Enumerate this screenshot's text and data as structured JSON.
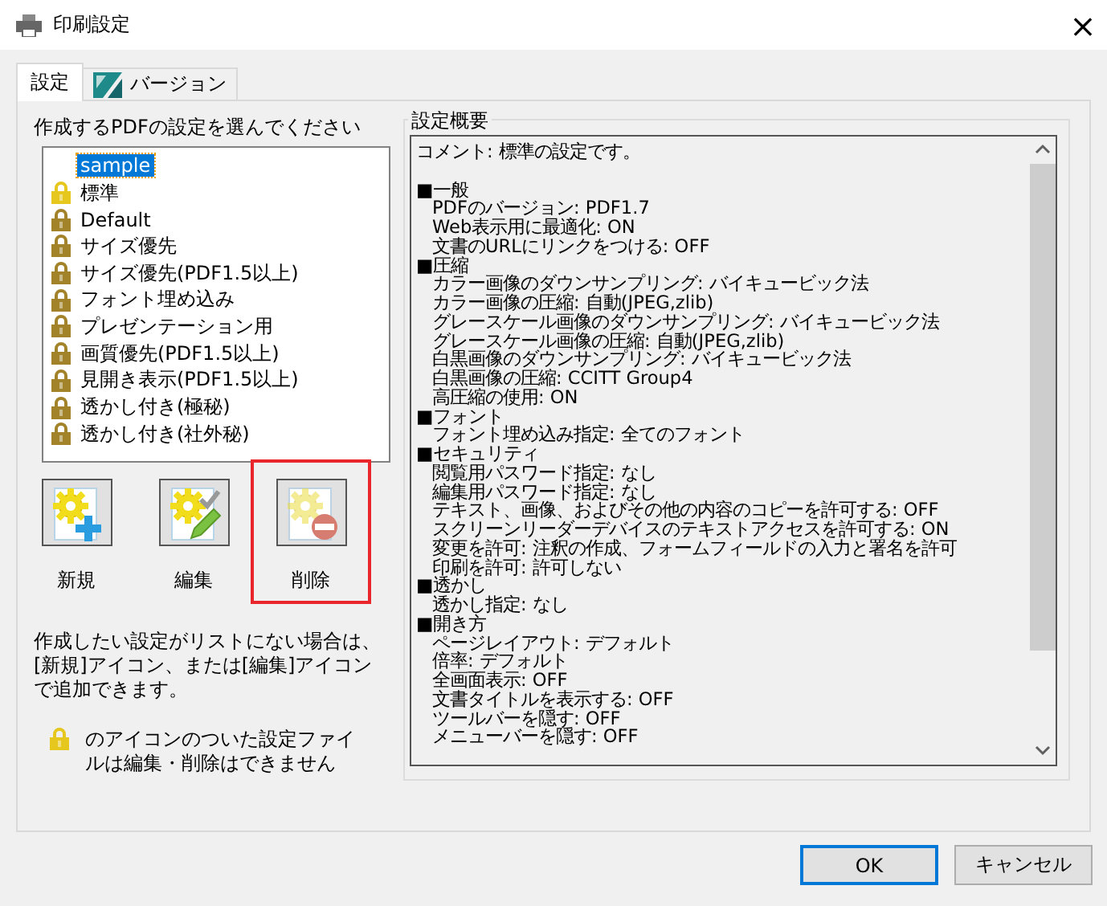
{
  "window": {
    "title": "印刷設定",
    "close": "×"
  },
  "tabs": [
    {
      "label": "設定",
      "selected": true,
      "kind": "plain"
    },
    {
      "label": "バージョン",
      "selected": false,
      "kind": "logo"
    }
  ],
  "settings": {
    "label": "作成するPDFの設定を選んでください",
    "items": [
      {
        "label": "sample",
        "locked": false,
        "selected": true
      },
      {
        "label": "標準",
        "locked": true,
        "selected": false,
        "color": "#e6c71e"
      },
      {
        "label": "Default",
        "locked": true,
        "selected": false,
        "color": "#a3832a"
      },
      {
        "label": "サイズ優先",
        "locked": true,
        "selected": false,
        "color": "#a3832a"
      },
      {
        "label": "サイズ優先(PDF1.5以上)",
        "locked": true,
        "selected": false,
        "color": "#a3832a"
      },
      {
        "label": "フォント埋め込み",
        "locked": true,
        "selected": false,
        "color": "#a3832a"
      },
      {
        "label": "プレゼンテーション用",
        "locked": true,
        "selected": false,
        "color": "#a3832a"
      },
      {
        "label": "画質優先(PDF1.5以上)",
        "locked": true,
        "selected": false,
        "color": "#a3832a"
      },
      {
        "label": "見開き表示(PDF1.5以上)",
        "locked": true,
        "selected": false,
        "color": "#a3832a"
      },
      {
        "label": "透かし付き(極秘)",
        "locked": true,
        "selected": false,
        "color": "#a3832a"
      },
      {
        "label": "透かし付き(社外秘)",
        "locked": true,
        "selected": false,
        "color": "#a3832a"
      }
    ],
    "actions": [
      {
        "label": "新規",
        "kind": "new",
        "disabled": false,
        "highlighted": false
      },
      {
        "label": "編集",
        "kind": "edit",
        "disabled": false,
        "highlighted": false
      },
      {
        "label": "削除",
        "kind": "delete",
        "disabled": true,
        "highlighted": true
      }
    ],
    "help": "作成したい設定がリストにない場合は、[新規]アイコン、または[編集]アイコンで追加できます。",
    "lock_note": "のアイコンのついた設定ファイルは編集・削除はできません"
  },
  "summary": {
    "title": "設定概要",
    "comment": "コメント:  標準の設定です。",
    "sections": [
      {
        "heading": "■一般",
        "items": [
          "PDFのバージョン: PDF1.7",
          "Web表示用に最適化: ON",
          "文書のURLにリンクをつける: OFF"
        ]
      },
      {
        "heading": "■圧縮",
        "items": [
          "カラー画像のダウンサンプリング: バイキュービック法",
          "カラー画像の圧縮: 自動(JPEG,zlib)",
          "グレースケール画像のダウンサンプリング: バイキュービック法",
          "グレースケール画像の圧縮: 自動(JPEG,zlib)",
          "白黒画像のダウンサンプリング: バイキュービック法",
          "白黒画像の圧縮: CCITT Group4",
          "高圧縮の使用: ON"
        ]
      },
      {
        "heading": "■フォント",
        "items": [
          "フォント埋め込み指定: 全てのフォント"
        ]
      },
      {
        "heading": "■セキュリティ",
        "items": [
          "閲覧用パスワード指定: なし",
          "編集用パスワード指定: なし",
          "テキスト、画像、およびその他の内容のコピーを許可する: OFF",
          "スクリーンリーダーデバイスのテキストアクセスを許可する: ON",
          "変更を許可: 注釈の作成、フォームフィールドの入力と署名を許可",
          "印刷を許可: 許可しない"
        ]
      },
      {
        "heading": "■透かし",
        "items": [
          "透かし指定: なし"
        ]
      },
      {
        "heading": "■開き方",
        "items": [
          "ページレイアウト: デフォルト",
          "倍率: デフォルト",
          "全画面表示: OFF",
          "文書タイトルを表示する: OFF",
          "ツールバーを隠す: OFF",
          "メニューバーを隠す: OFF"
        ]
      }
    ]
  },
  "buttons": [
    {
      "label": "OK",
      "kind": "default"
    },
    {
      "label": "キャンセル",
      "kind": "normal"
    }
  ]
}
